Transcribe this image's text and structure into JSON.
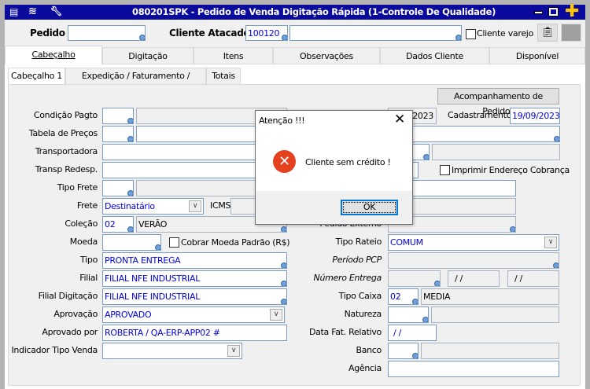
{
  "window": {
    "title": "080201SPK - Pedido de Venda Digitação Rápida (1-Controle De Qualidade)"
  },
  "top": {
    "pedido_label": "Pedido",
    "pedido_value": "",
    "cliente_label": "Cliente Atacado",
    "cliente_code": "100120",
    "cliente_name": "",
    "varejo_label": "Cliente varejo"
  },
  "tabs": [
    "Cabeçalho",
    "Digitação",
    "Itens",
    "Observações",
    "Dados Cliente",
    "Disponível"
  ],
  "subtabs": [
    "Cabeçalho 1",
    "Expedição / Faturamento / Vendas",
    "Totais"
  ],
  "form": {
    "acompanhamento": "Acompanhamento de Pedidos",
    "condicao_pagto": "Condição Pagto",
    "tabela_precos": "Tabela de Preços",
    "transportadora": "Transportadora",
    "transp_redesp": "Transp Redesp.",
    "tipo_frete": "Tipo Frete",
    "frete": "Frete",
    "frete_value": "Destinatário",
    "icms": "ICMS",
    "colecao": "Coleção",
    "colecao_code": "02",
    "colecao_name": "VERÃO",
    "moeda": "Moeda",
    "cobrar_moeda": "Cobrar Moeda Padrão (R$)",
    "tipo": "Tipo",
    "tipo_value": "PRONTA ENTREGA",
    "filial": "Filial",
    "filial_value": "FILIAL NFE INDUSTRIAL",
    "filial_digitacao": "Filial Digitação",
    "filial_digitacao_value": "FILIAL NFE INDUSTRIAL",
    "aprovacao": "Aprovação",
    "aprovacao_value": "APROVADO",
    "aprovado_por": "Aprovado por",
    "aprovado_por_value": "ROBERTA / QA-ERP-APP02 #",
    "indicador_tipo_venda": "Indicador Tipo Venda",
    "data_partial": "/2023",
    "cadastramento": "Cadastramento",
    "cadastramento_value": "19/09/2023",
    "imprimir_endereco": "Imprimir Endereço Cobrança",
    "pedido_externo": "Pedido Externo",
    "tipo_rateio": "Tipo Rateio",
    "tipo_rateio_value": "COMUM",
    "periodo_pcp": "Período PCP",
    "numero_entrega": "Número Entrega",
    "date_empty1": "/ /",
    "date_empty2": "/ /",
    "tipo_caixa": "Tipo Caixa",
    "tipo_caixa_code": "02",
    "tipo_caixa_name": "MEDIA",
    "natureza": "Natureza",
    "data_fat_relativo": "Data Fat. Relativo",
    "data_fat_value": " / /",
    "banco": "Banco",
    "agencia": "Agência"
  },
  "dialog": {
    "title": "Atenção !!!",
    "message": "Cliente sem crédito !",
    "ok": "OK"
  }
}
